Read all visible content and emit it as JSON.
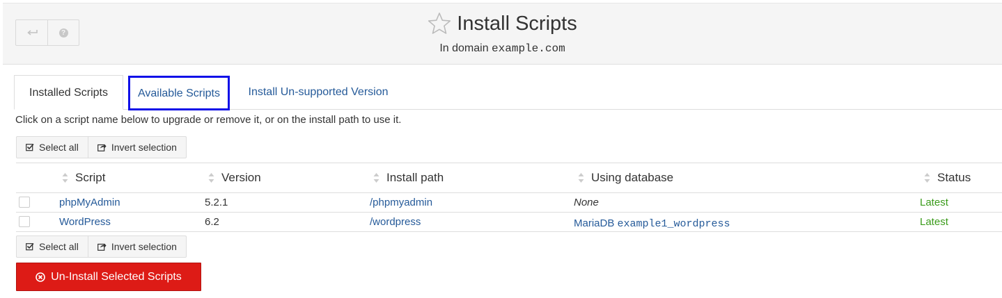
{
  "header": {
    "title": "Install Scripts",
    "subtitle_prefix": "In domain",
    "domain": "example.com",
    "back_icon": "back-arrow-icon",
    "help_icon": "help-icon"
  },
  "tabs": [
    {
      "label": "Installed Scripts",
      "active": true
    },
    {
      "label": "Available Scripts",
      "active": false
    },
    {
      "label": "Install Un-supported Version",
      "active": false
    }
  ],
  "instructions": "Click on a script name below to upgrade or remove it, or on the install path to use it.",
  "selection": {
    "select_all": "Select all",
    "invert": "Invert selection"
  },
  "table": {
    "columns": [
      "Script",
      "Version",
      "Install path",
      "Using database",
      "Status"
    ],
    "rows": [
      {
        "script": "phpMyAdmin",
        "version": "5.2.1",
        "path": "/phpmyadmin",
        "db_none": "None",
        "status": "Latest"
      },
      {
        "script": "WordPress",
        "version": "6.2",
        "path": "/wordpress",
        "db_type": "MariaDB",
        "db_name": "example1_wordpress",
        "status": "Latest"
      }
    ]
  },
  "uninstall_button": "Un-Install Selected Scripts",
  "colors": {
    "link": "#255a99",
    "danger": "#dd1b16",
    "success": "#3a9b1a",
    "highlight": "#1010e8"
  }
}
